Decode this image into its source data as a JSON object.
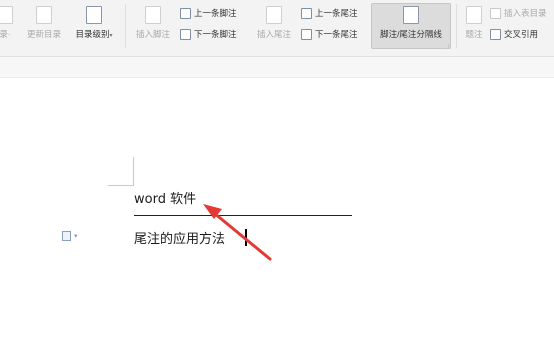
{
  "ribbon": {
    "toc_update_partial": "录·",
    "update_toc": "更新目录",
    "toc_level": "目录级别",
    "insert_footnote": "插入脚注",
    "prev_footnote": "上一条脚注",
    "next_footnote": "下一条脚注",
    "insert_endnote": "插入尾注",
    "prev_endnote": "上一条尾注",
    "next_endnote": "下一条尾注",
    "separator_line": "脚注/尾注分隔线",
    "insert_table_of_figures": "插入表目录",
    "footnote_partial": "题注",
    "cross_reference": "交叉引用"
  },
  "document": {
    "footnote_line_1": "word 软件",
    "footnote_line_2": "尾注的应用方法"
  },
  "colors": {
    "arrow": "#e53935",
    "ribbon_bg": "#f3f3f3",
    "active_button_bg": "#dcdcdc"
  }
}
